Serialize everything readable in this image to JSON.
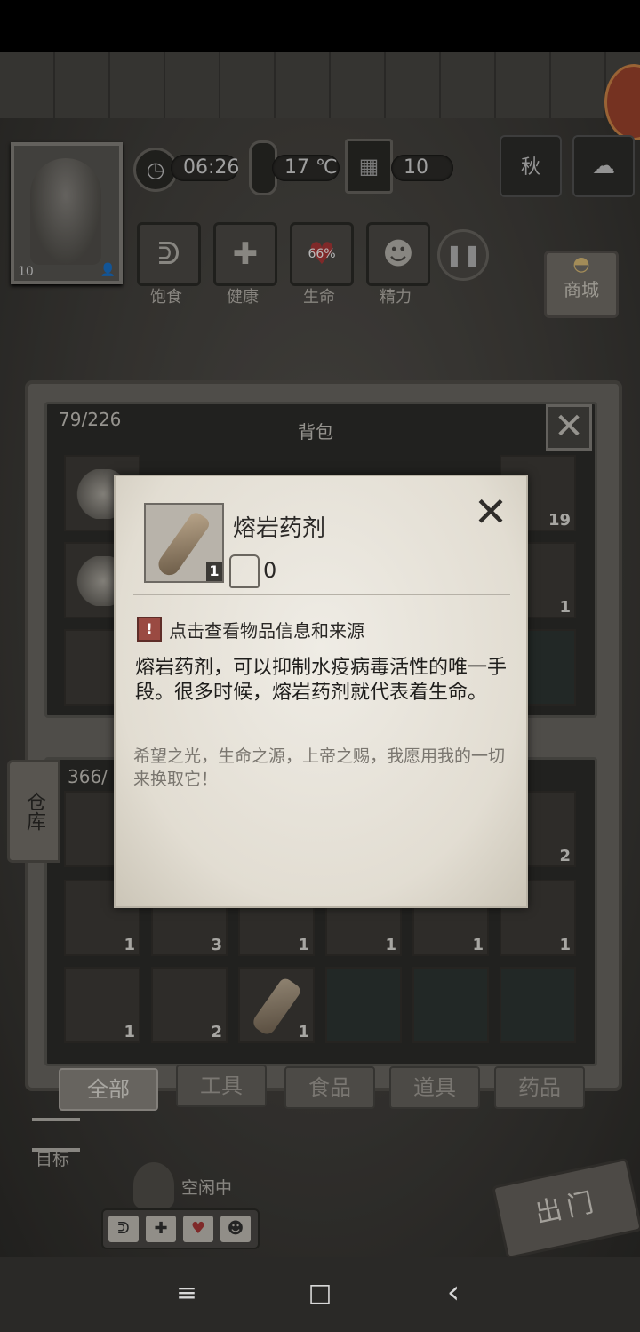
{
  "hud": {
    "time": "06:26",
    "temperature": "17 ℃",
    "day": "10",
    "season": "秋",
    "player_level": "10"
  },
  "status": {
    "hunger": "饱食",
    "health": "健康",
    "life": "生命",
    "life_percent": "66%",
    "energy": "精力"
  },
  "shop": {
    "label": "商城"
  },
  "backpack": {
    "title": "背包",
    "count": "79/226",
    "slot_counts": {
      "row1_last": "19",
      "row2_last": "1"
    }
  },
  "storage": {
    "tab_label": "仓库",
    "count": "366/",
    "slot_counts": [
      "1",
      "3",
      "1",
      "1",
      "1",
      "1",
      "1",
      "2",
      "1"
    ],
    "row1_last": "2"
  },
  "filters": [
    "全部",
    "工具",
    "食品",
    "道具",
    "药品"
  ],
  "bottom": {
    "goal": "目标",
    "idle": "空闲中",
    "exit": "出门"
  },
  "item_popup": {
    "name": "熔岩药剂",
    "quantity": "1",
    "weight": "0",
    "info_hint": "点击查看物品信息和来源",
    "description": "熔岩药剂，可以抑制水疫病毒活性的唯一手段。很多时候，熔岩药剂就代表着生命。",
    "flavor": "希望之光，生命之源，上帝之赐，我愿用我的一切来换取它！"
  },
  "nav": {
    "menu": "≡",
    "home": "□",
    "back": "‹"
  }
}
